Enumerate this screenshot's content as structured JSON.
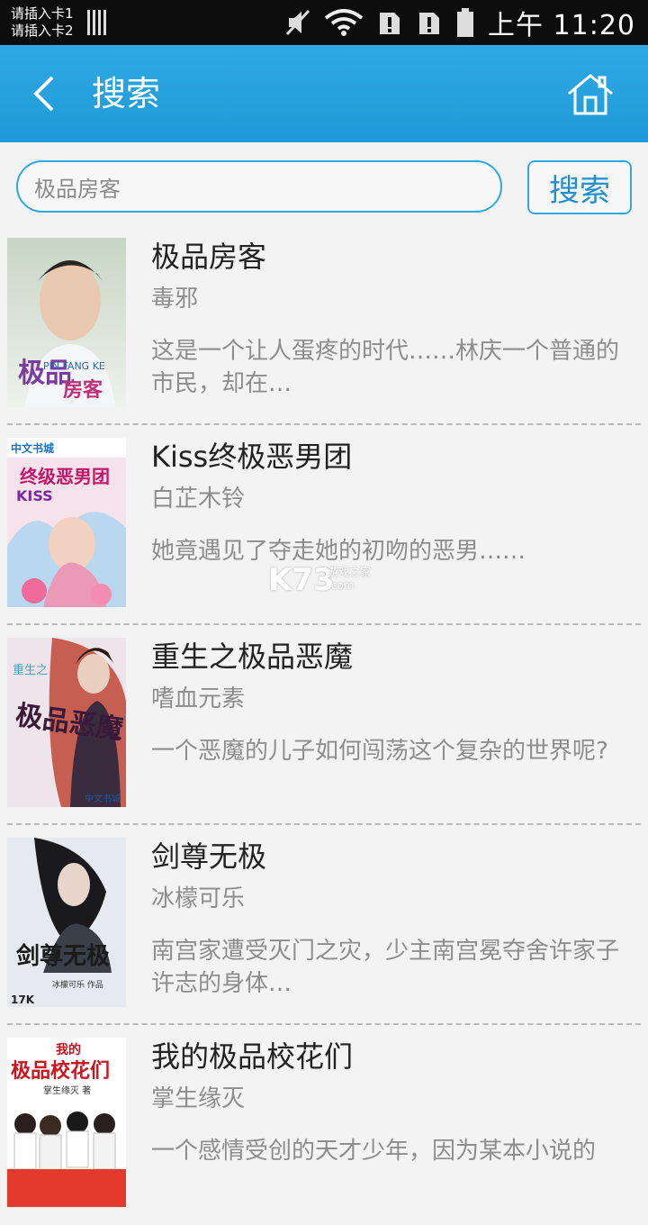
{
  "status_bar": {
    "sim1": "请插入卡1",
    "sim2": "请插入卡2",
    "time": "上午 11:20"
  },
  "header": {
    "title": "搜索",
    "back_icon": "chevron-left-icon",
    "home_icon": "home-icon"
  },
  "search": {
    "query": "极品房客",
    "button_label": "搜索"
  },
  "results": [
    {
      "title": "极品房客",
      "author": "毒邪",
      "desc": "这是一个让人蛋疼的时代……林庆一个普通的市民，却在…"
    },
    {
      "title": "Kiss终极恶男团",
      "author": "白芷木铃",
      "desc": "她竟遇见了夺走她的初吻的恶男……"
    },
    {
      "title": "重生之极品恶魔",
      "author": "嗜血元素",
      "desc": "一个恶魔的儿子如何闯荡这个复杂的世界呢?"
    },
    {
      "title": "剑尊无极",
      "author": "冰檬可乐",
      "desc": "南宫家遭受灭门之灾，少主南宫冕夺舍许家子许志的身体…"
    },
    {
      "title": "我的极品校花们",
      "author": "掌生缘灭",
      "desc": "一个感情受创的天才少年，因为某本小说的"
    }
  ],
  "covers": {
    "0": {
      "line1": "极品",
      "line2": "房客",
      "brand": "PIN FANG KE"
    },
    "1": {
      "line1": "中文书城",
      "line2": "终级恶男团",
      "brand": "KISS"
    },
    "2": {
      "line1": "极品恶魔",
      "line2": "重生之",
      "brand": "中文书城"
    },
    "3": {
      "line1": "剑尊无极",
      "line2": "冰檬可乐 作品",
      "brand": "17K"
    },
    "4": {
      "line1": "我的",
      "line2": "极品校花们",
      "brand": "掌生缘灭 著"
    }
  },
  "watermark": {
    "main": "K73",
    "sub": "游戏之家",
    "domain": ".com"
  },
  "colors": {
    "accent": "#2ea9e4",
    "header": "#1e9ad8",
    "text_muted": "#8d8d8d"
  }
}
